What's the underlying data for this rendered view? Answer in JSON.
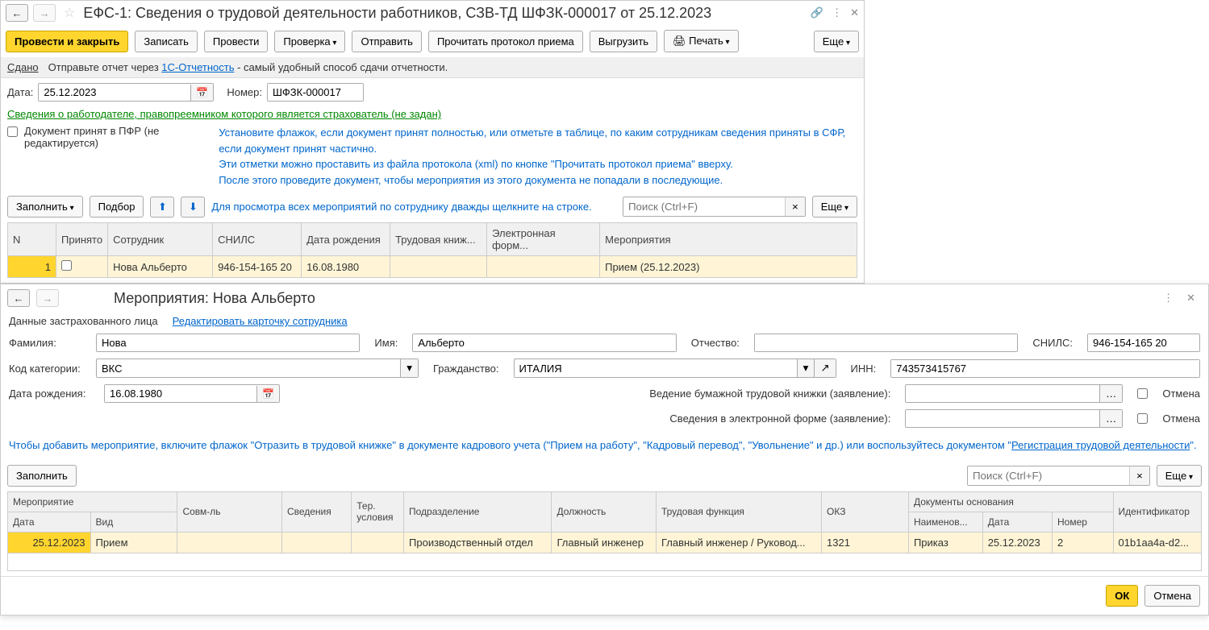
{
  "main": {
    "title": "ЕФС-1: Сведения о трудовой деятельности работников, СЗВ-ТД ШФЗК-000017 от 25.12.2023",
    "toolbar": {
      "post_close": "Провести и закрыть",
      "save": "Записать",
      "post": "Провести",
      "check": "Проверка",
      "send": "Отправить",
      "read_protocol": "Прочитать протокол приема",
      "export": "Выгрузить",
      "print": "Печать",
      "more": "Еще"
    },
    "infobar": {
      "status": "Сдано",
      "hint_pre": "Отправьте отчет через ",
      "hint_link": "1С-Отчетность",
      "hint_post": " - самый удобный способ сдачи отчетности."
    },
    "form": {
      "date_label": "Дата:",
      "date": "25.12.2023",
      "number_label": "Номер:",
      "number": "ШФЗК-000017"
    },
    "employer_link": "Сведения о работодателе, правопреемником которого является страхователь (не задан)",
    "accepted_checkbox": "Документ принят в ПФР (не редактируется)",
    "accepted_note": "Установите флажок, если документ принят полностью, или отметьте в таблице, по каким сотрудникам сведения приняты в СФР, если документ принят частично.\nЭти отметки можно проставить из файла протокола (xml) по кнопке \"Прочитать протокол приема\" вверху.\nПосле этого проведите документ, чтобы мероприятия из этого документа не попадали в последующие.",
    "table_toolbar": {
      "fill": "Заполнить",
      "select": "Подбор",
      "hint": "Для просмотра всех мероприятий по сотруднику дважды щелкните на строке.",
      "search_placeholder": "Поиск (Ctrl+F)",
      "more": "Еще"
    },
    "table": {
      "headers": [
        "N",
        "Принято",
        "Сотрудник",
        "СНИЛС",
        "Дата рождения",
        "Трудовая книж...",
        "Электронная форм...",
        "Мероприятия"
      ],
      "rows": [
        {
          "n": "1",
          "accepted": false,
          "employee": "Нова Альберто",
          "snils": "946-154-165 20",
          "birthdate": "16.08.1980",
          "workbook": "",
          "eform": "",
          "events": "Прием (25.12.2023)"
        }
      ]
    }
  },
  "sub": {
    "title": "Мероприятия: Нова Альберто",
    "insured_label": "Данные застрахованного лица",
    "edit_card_link": "Редактировать карточку сотрудника",
    "fields": {
      "lastname_label": "Фамилия:",
      "lastname": "Нова",
      "firstname_label": "Имя:",
      "firstname": "Альберто",
      "middlename_label": "Отчество:",
      "middlename": "",
      "snils_label": "СНИЛС:",
      "snils": "946-154-165 20",
      "category_label": "Код категории:",
      "category": "ВКС",
      "citizenship_label": "Гражданство:",
      "citizenship": "ИТАЛИЯ",
      "inn_label": "ИНН:",
      "inn": "743573415767",
      "birthdate_label": "Дата рождения:",
      "birthdate": "16.08.1980",
      "paper_book_label": "Ведение бумажной трудовой книжки (заявление):",
      "eform_label": "Сведения в электронной форме (заявление):",
      "cancel": "Отмена"
    },
    "help": {
      "p1": "Чтобы добавить мероприятие, включите флажок \"Отразить в трудовой книжке\" в документе кадрового учета (\"Прием на работу\", \"Кадровый перевод\", \"Увольнение\" и др.) или воспользуйтесь документом \"",
      "link": "Регистрация трудовой деятельности",
      "p2": "\"."
    },
    "events_toolbar": {
      "fill": "Заполнить",
      "search_placeholder": "Поиск (Ctrl+F)",
      "more": "Еще"
    },
    "events_table": {
      "headers_top": [
        "Мероприятие",
        "Совм-ль",
        "Сведения",
        "Тер. условия",
        "Подразделение",
        "Должность",
        "Трудовая функция",
        "ОКЗ",
        "Документы основания",
        "Идентификатор"
      ],
      "headers_sub": [
        "Дата",
        "Вид",
        "",
        "",
        "",
        "",
        "",
        "",
        "",
        "Наименов...",
        "Дата",
        "Номер",
        ""
      ],
      "rows": [
        {
          "date": "25.12.2023",
          "kind": "Прием",
          "dept": "Производственный отдел",
          "pos": "Главный инженер",
          "func": "Главный инженер / Руковод...",
          "okz": "1321",
          "doc_name": "Приказ",
          "doc_date": "25.12.2023",
          "doc_num": "2",
          "id": "01b1aa4a-d2..."
        }
      ]
    },
    "footer": {
      "ok": "ОК",
      "cancel": "Отмена"
    }
  }
}
